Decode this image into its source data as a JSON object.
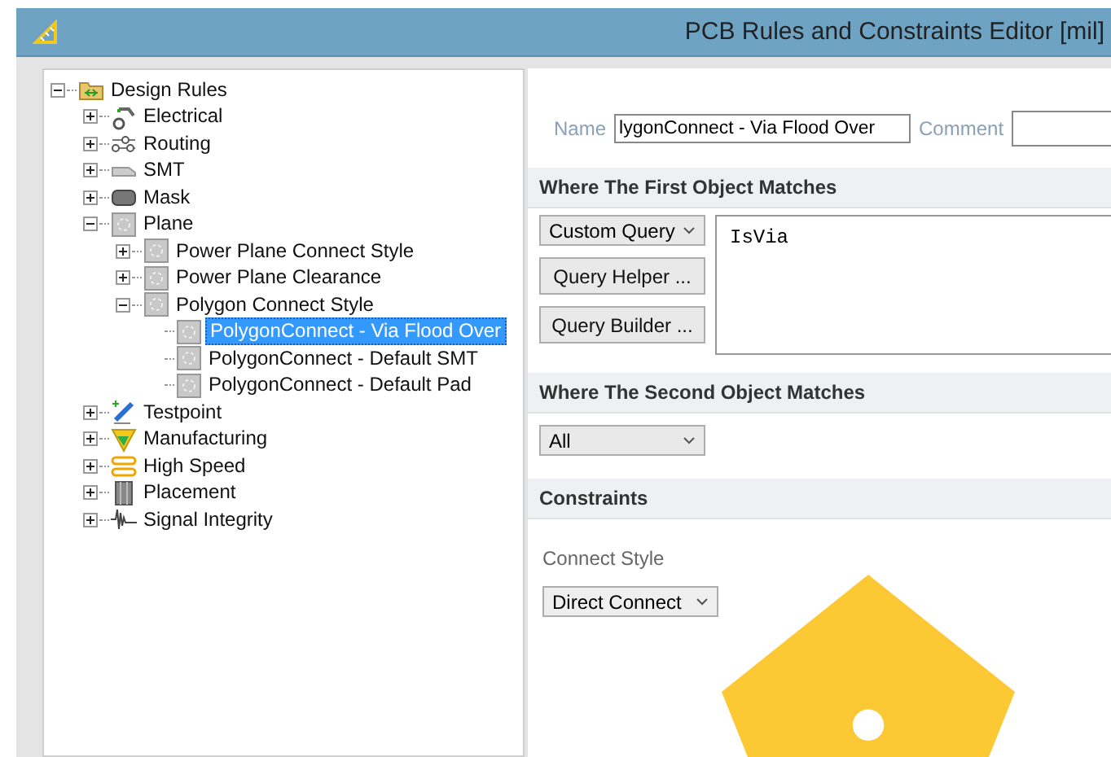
{
  "window": {
    "title": "PCB Rules and Constraints Editor [mil]"
  },
  "tree": [
    {
      "label": "Design Rules",
      "kind": "folder",
      "expanded": true,
      "selected": false,
      "children": [
        {
          "label": "Electrical",
          "kind": "electrical",
          "expanded": false,
          "selected": false
        },
        {
          "label": "Routing",
          "kind": "routing",
          "expanded": false,
          "selected": false
        },
        {
          "label": "SMT",
          "kind": "smt",
          "expanded": false,
          "selected": false
        },
        {
          "label": "Mask",
          "kind": "mask",
          "expanded": false,
          "selected": false
        },
        {
          "label": "Plane",
          "kind": "plane",
          "expanded": true,
          "selected": false,
          "children": [
            {
              "label": "Power Plane Connect Style",
              "kind": "plane",
              "expanded": false,
              "selected": false
            },
            {
              "label": "Power Plane Clearance",
              "kind": "plane",
              "expanded": false,
              "selected": false
            },
            {
              "label": "Polygon Connect Style",
              "kind": "plane",
              "expanded": true,
              "selected": false,
              "children": [
                {
                  "label": "PolygonConnect - Via Flood Over",
                  "kind": "plane",
                  "selected": true
                },
                {
                  "label": "PolygonConnect - Default SMT",
                  "kind": "plane",
                  "selected": false
                },
                {
                  "label": "PolygonConnect - Default Pad",
                  "kind": "plane",
                  "selected": false
                }
              ]
            }
          ]
        },
        {
          "label": "Testpoint",
          "kind": "testpoint",
          "expanded": false,
          "selected": false
        },
        {
          "label": "Manufacturing",
          "kind": "manufacturing",
          "expanded": false,
          "selected": false
        },
        {
          "label": "High Speed",
          "kind": "highspeed",
          "expanded": false,
          "selected": false
        },
        {
          "label": "Placement",
          "kind": "placement",
          "expanded": false,
          "selected": false
        },
        {
          "label": "Signal Integrity",
          "kind": "signal",
          "expanded": false,
          "selected": false
        }
      ]
    }
  ],
  "rule": {
    "name_label": "Name",
    "name_value": "lygonConnect - Via Flood Over",
    "comment_label": "Comment"
  },
  "first_match": {
    "header": "Where The First Object Matches",
    "scope": "Custom Query",
    "query": "IsVia",
    "buttons": [
      "Query Helper ...",
      "Query Builder ..."
    ]
  },
  "second_match": {
    "header": "Where The Second Object Matches",
    "scope": "All"
  },
  "constraints": {
    "header": "Constraints",
    "connect_style_label": "Connect Style",
    "connect_style": "Direct Connect"
  }
}
